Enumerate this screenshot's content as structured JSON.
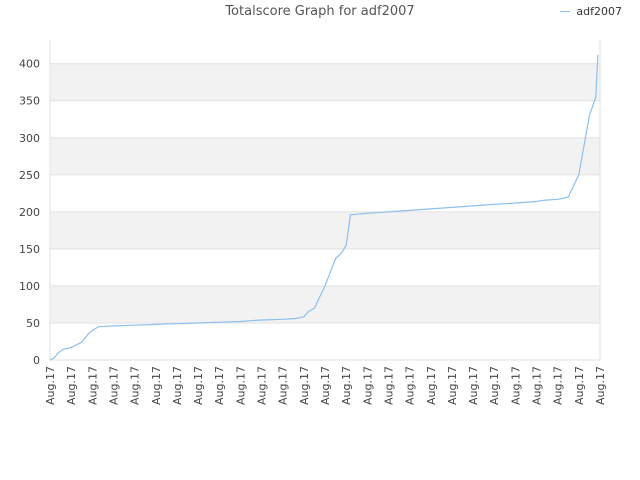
{
  "chart_data": {
    "type": "line",
    "title": "Totalscore Graph for adf2007",
    "xlabel": "",
    "ylabel": "",
    "ylim": [
      0,
      432
    ],
    "y_ticks": [
      0,
      50,
      100,
      150,
      200,
      250,
      300,
      350,
      400
    ],
    "x_tick_labels": [
      "Aug.17",
      "Aug.17",
      "Aug.17",
      "Aug.17",
      "Aug.17",
      "Aug.17",
      "Aug.17",
      "Aug.17",
      "Aug.17",
      "Aug.17",
      "Aug.17",
      "Aug.17",
      "Aug.17",
      "Aug.17",
      "Aug.17",
      "Aug.17",
      "Aug.17",
      "Aug.17",
      "Aug.17",
      "Aug.17",
      "Aug.17",
      "Aug.17",
      "Aug.17",
      "Aug.17",
      "Aug.17",
      "Aug.17",
      "Aug.17"
    ],
    "legend_position": "top-right",
    "grid": true,
    "colors": {
      "series": "#8cc0ee",
      "band": "#f2f2f2",
      "band_top": "#ebebeb",
      "grid": "#e2e2e2"
    },
    "series": [
      {
        "name": "adf2007",
        "x": [
          0,
          0.2,
          0.4,
          0.6,
          1.0,
          1.5,
          1.8,
          2.0,
          2.3,
          3.0,
          4.0,
          5.0,
          6.0,
          7.0,
          8.0,
          9.0,
          9.5,
          10.0,
          11.0,
          11.6,
          11.8,
          11.9,
          12.0,
          12.2,
          12.5,
          13.0,
          13.5,
          13.8,
          14.0,
          14.1,
          14.2,
          15.0,
          16.0,
          17.0,
          18.0,
          19.0,
          20.0,
          21.0,
          22.0,
          23.0,
          23.2,
          23.5,
          24.0,
          24.2,
          24.5,
          25.0,
          25.5,
          25.8,
          25.9
        ],
        "y": [
          0,
          3,
          10,
          14,
          17,
          24,
          35,
          40,
          45,
          46,
          47,
          48,
          49,
          50,
          51,
          52,
          53,
          54,
          55,
          56,
          57,
          58,
          58,
          65,
          70,
          100,
          137,
          145,
          155,
          175,
          196,
          198,
          200,
          202,
          204,
          206,
          208,
          210,
          212,
          214,
          215,
          216,
          217,
          218,
          220,
          250,
          330,
          355,
          412
        ]
      }
    ]
  }
}
